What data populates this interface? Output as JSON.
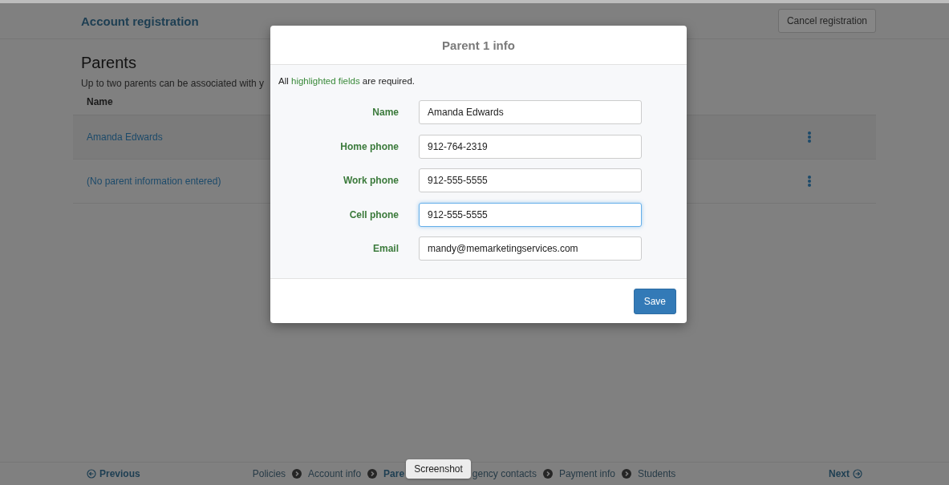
{
  "header": {
    "title": "Account registration",
    "cancel_button": "Cancel registration"
  },
  "page": {
    "heading": "Parents",
    "subtitle": "Up to two parents can be associated with y",
    "table": {
      "columns": [
        "Name"
      ],
      "rows": [
        {
          "name": "Amanda Edwards"
        },
        {
          "name": "(No parent information entered)"
        }
      ]
    }
  },
  "footer": {
    "previous": "Previous",
    "next": "Next",
    "steps": [
      {
        "label": "Policies",
        "selected": false
      },
      {
        "label": "Account info",
        "selected": false
      },
      {
        "label": "Pare",
        "selected": true
      },
      {
        "label": "gency contacts",
        "selected": false
      },
      {
        "label": "Payment info",
        "selected": false
      },
      {
        "label": "Students",
        "selected": false
      }
    ]
  },
  "tooltip": {
    "text": "Screenshot"
  },
  "dialog": {
    "title": "Parent 1 info",
    "note_parts": [
      "All ",
      "highlighted fields",
      " are required."
    ],
    "fields": [
      {
        "label": "Name",
        "value": "Amanda Edwards",
        "focused": false
      },
      {
        "label": "Home phone",
        "value": "912-764-2319",
        "focused": false
      },
      {
        "label": "Work phone",
        "value": "912-555-5555",
        "focused": false
      },
      {
        "label": "Cell phone",
        "value": "912-555-5555",
        "focused": true
      },
      {
        "label": "Email",
        "value": "mandy@memarketingservices.com",
        "focused": false
      }
    ],
    "save_button": "Save"
  }
}
